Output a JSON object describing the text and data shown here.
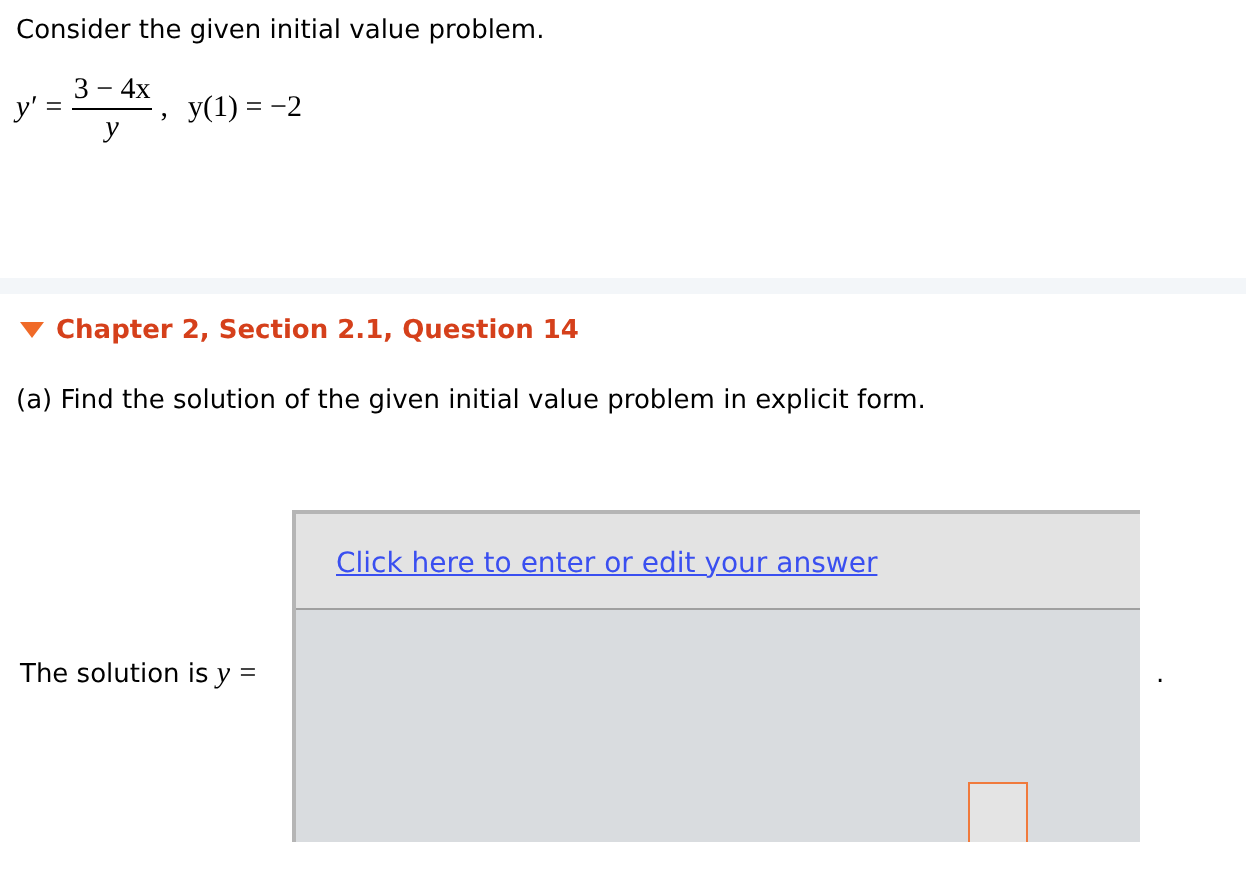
{
  "problem": {
    "intro": "Consider the given initial value problem.",
    "equation": {
      "lhs": "y′ =",
      "numerator": "3 − 4x",
      "denominator": "y",
      "separator": ",",
      "condition": "y(1) = −2"
    }
  },
  "question": {
    "title": "Chapter 2, Section 2.1, Question 14",
    "expanded": true,
    "part": "(a) Find the solution of the given initial value problem in explicit form.",
    "answer": {
      "label": "The solution is",
      "variable": "y =",
      "edit_link": "Click here to enter or edit your answer",
      "trailing": "."
    }
  }
}
